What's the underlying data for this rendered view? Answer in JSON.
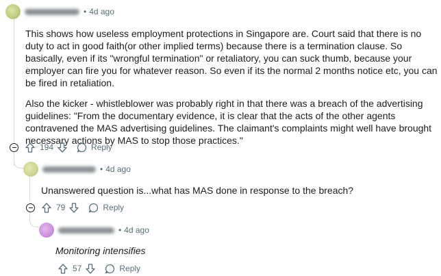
{
  "comments": [
    {
      "username": "",
      "time": "4d ago",
      "paragraphs": [
        "This shows how useless employment protections in Singapore are. Court said that there is no duty to act in good faith(or other implied terms) because there is a termination clause. So basically, even if its \"wrongful termination\" or retaliatory, you can suck thumb, because your employer can fire you for whatever reason. So even if its the normal 2 months notice etc, you can be fired in retaliation.",
        "Also the kicker - whistleblower was probably right in that there was a breach of the advertising guidelines: \"From the documentary evidence, it is clear that the acts of the other agents contravened the MAS advertising guidelines. The claimant's complaints might well have brought necessary actions by MAS to stop those practices.\""
      ],
      "votes": "194",
      "reply_label": "Reply",
      "avatar_color": "#b8c47a"
    },
    {
      "username": "",
      "time": "4d ago",
      "text": "Unanswered question is...what has MAS done in response to the breach?",
      "votes": "79",
      "reply_label": "Reply",
      "avatar_color": "#c9cf8a"
    },
    {
      "username": "",
      "time": "4d ago",
      "text": "Monitoring intensifies",
      "votes": "57",
      "reply_label": "Reply",
      "avatar_color": "#c98ad6"
    }
  ],
  "icons": {
    "upvote": "arrow-up-icon",
    "downvote": "arrow-down-icon",
    "reply": "speech-bubble-icon",
    "collapse": "minus-circle-icon"
  },
  "colors": {
    "meta": "#576f76",
    "thread_line": "#d6dadc",
    "text": "#1c1c1c"
  }
}
